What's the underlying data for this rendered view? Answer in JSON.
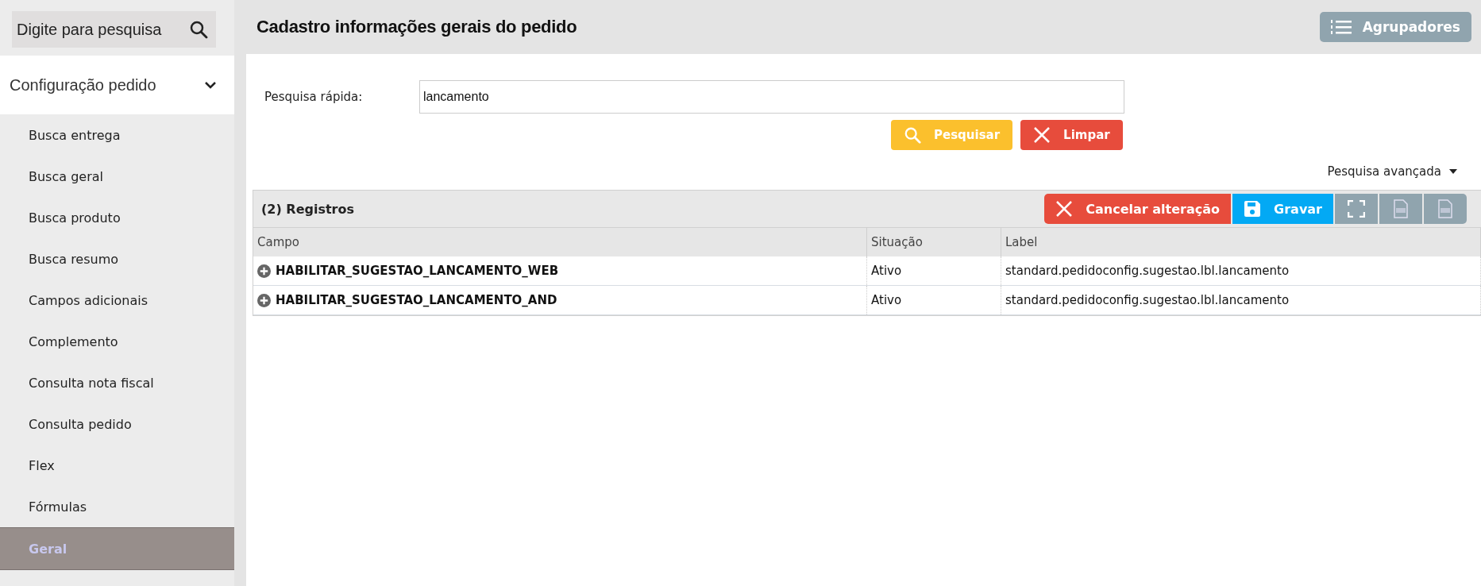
{
  "sidebar": {
    "search": {
      "placeholder": "Digite para pesquisa"
    },
    "group": {
      "label": "Configuração pedido",
      "expanded": true
    },
    "items": [
      {
        "label": "Busca entrega",
        "selected": false
      },
      {
        "label": "Busca geral",
        "selected": false
      },
      {
        "label": "Busca produto",
        "selected": false
      },
      {
        "label": "Busca resumo",
        "selected": false
      },
      {
        "label": "Campos adicionais",
        "selected": false
      },
      {
        "label": "Complemento",
        "selected": false
      },
      {
        "label": "Consulta nota fiscal",
        "selected": false
      },
      {
        "label": "Consulta pedido",
        "selected": false
      },
      {
        "label": "Flex",
        "selected": false
      },
      {
        "label": "Fórmulas",
        "selected": false
      },
      {
        "label": "Geral",
        "selected": true
      }
    ]
  },
  "header": {
    "title": "Cadastro informações gerais do pedido",
    "group_button": "Agrupadores"
  },
  "quick_search": {
    "label": "Pesquisa rápida:",
    "value": "lancamento",
    "search_button": "Pesquisar",
    "clear_button": "Limpar",
    "advanced": "Pesquisa avançada"
  },
  "table": {
    "count": "(2) Registros",
    "cancel_button": "Cancelar alteração",
    "save_button": "Gravar",
    "columns": [
      "Campo",
      "Situação",
      "Label"
    ],
    "rows": [
      {
        "campo": "HABILITAR_SUGESTAO_LANCAMENTO_WEB",
        "situacao": "Ativo",
        "label": "standard.pedidoconfig.sugestao.lbl.lancamento"
      },
      {
        "campo": "HABILITAR_SUGESTAO_LANCAMENTO_AND",
        "situacao": "Ativo",
        "label": "standard.pedidoconfig.sugestao.lbl.lancamento"
      }
    ]
  }
}
